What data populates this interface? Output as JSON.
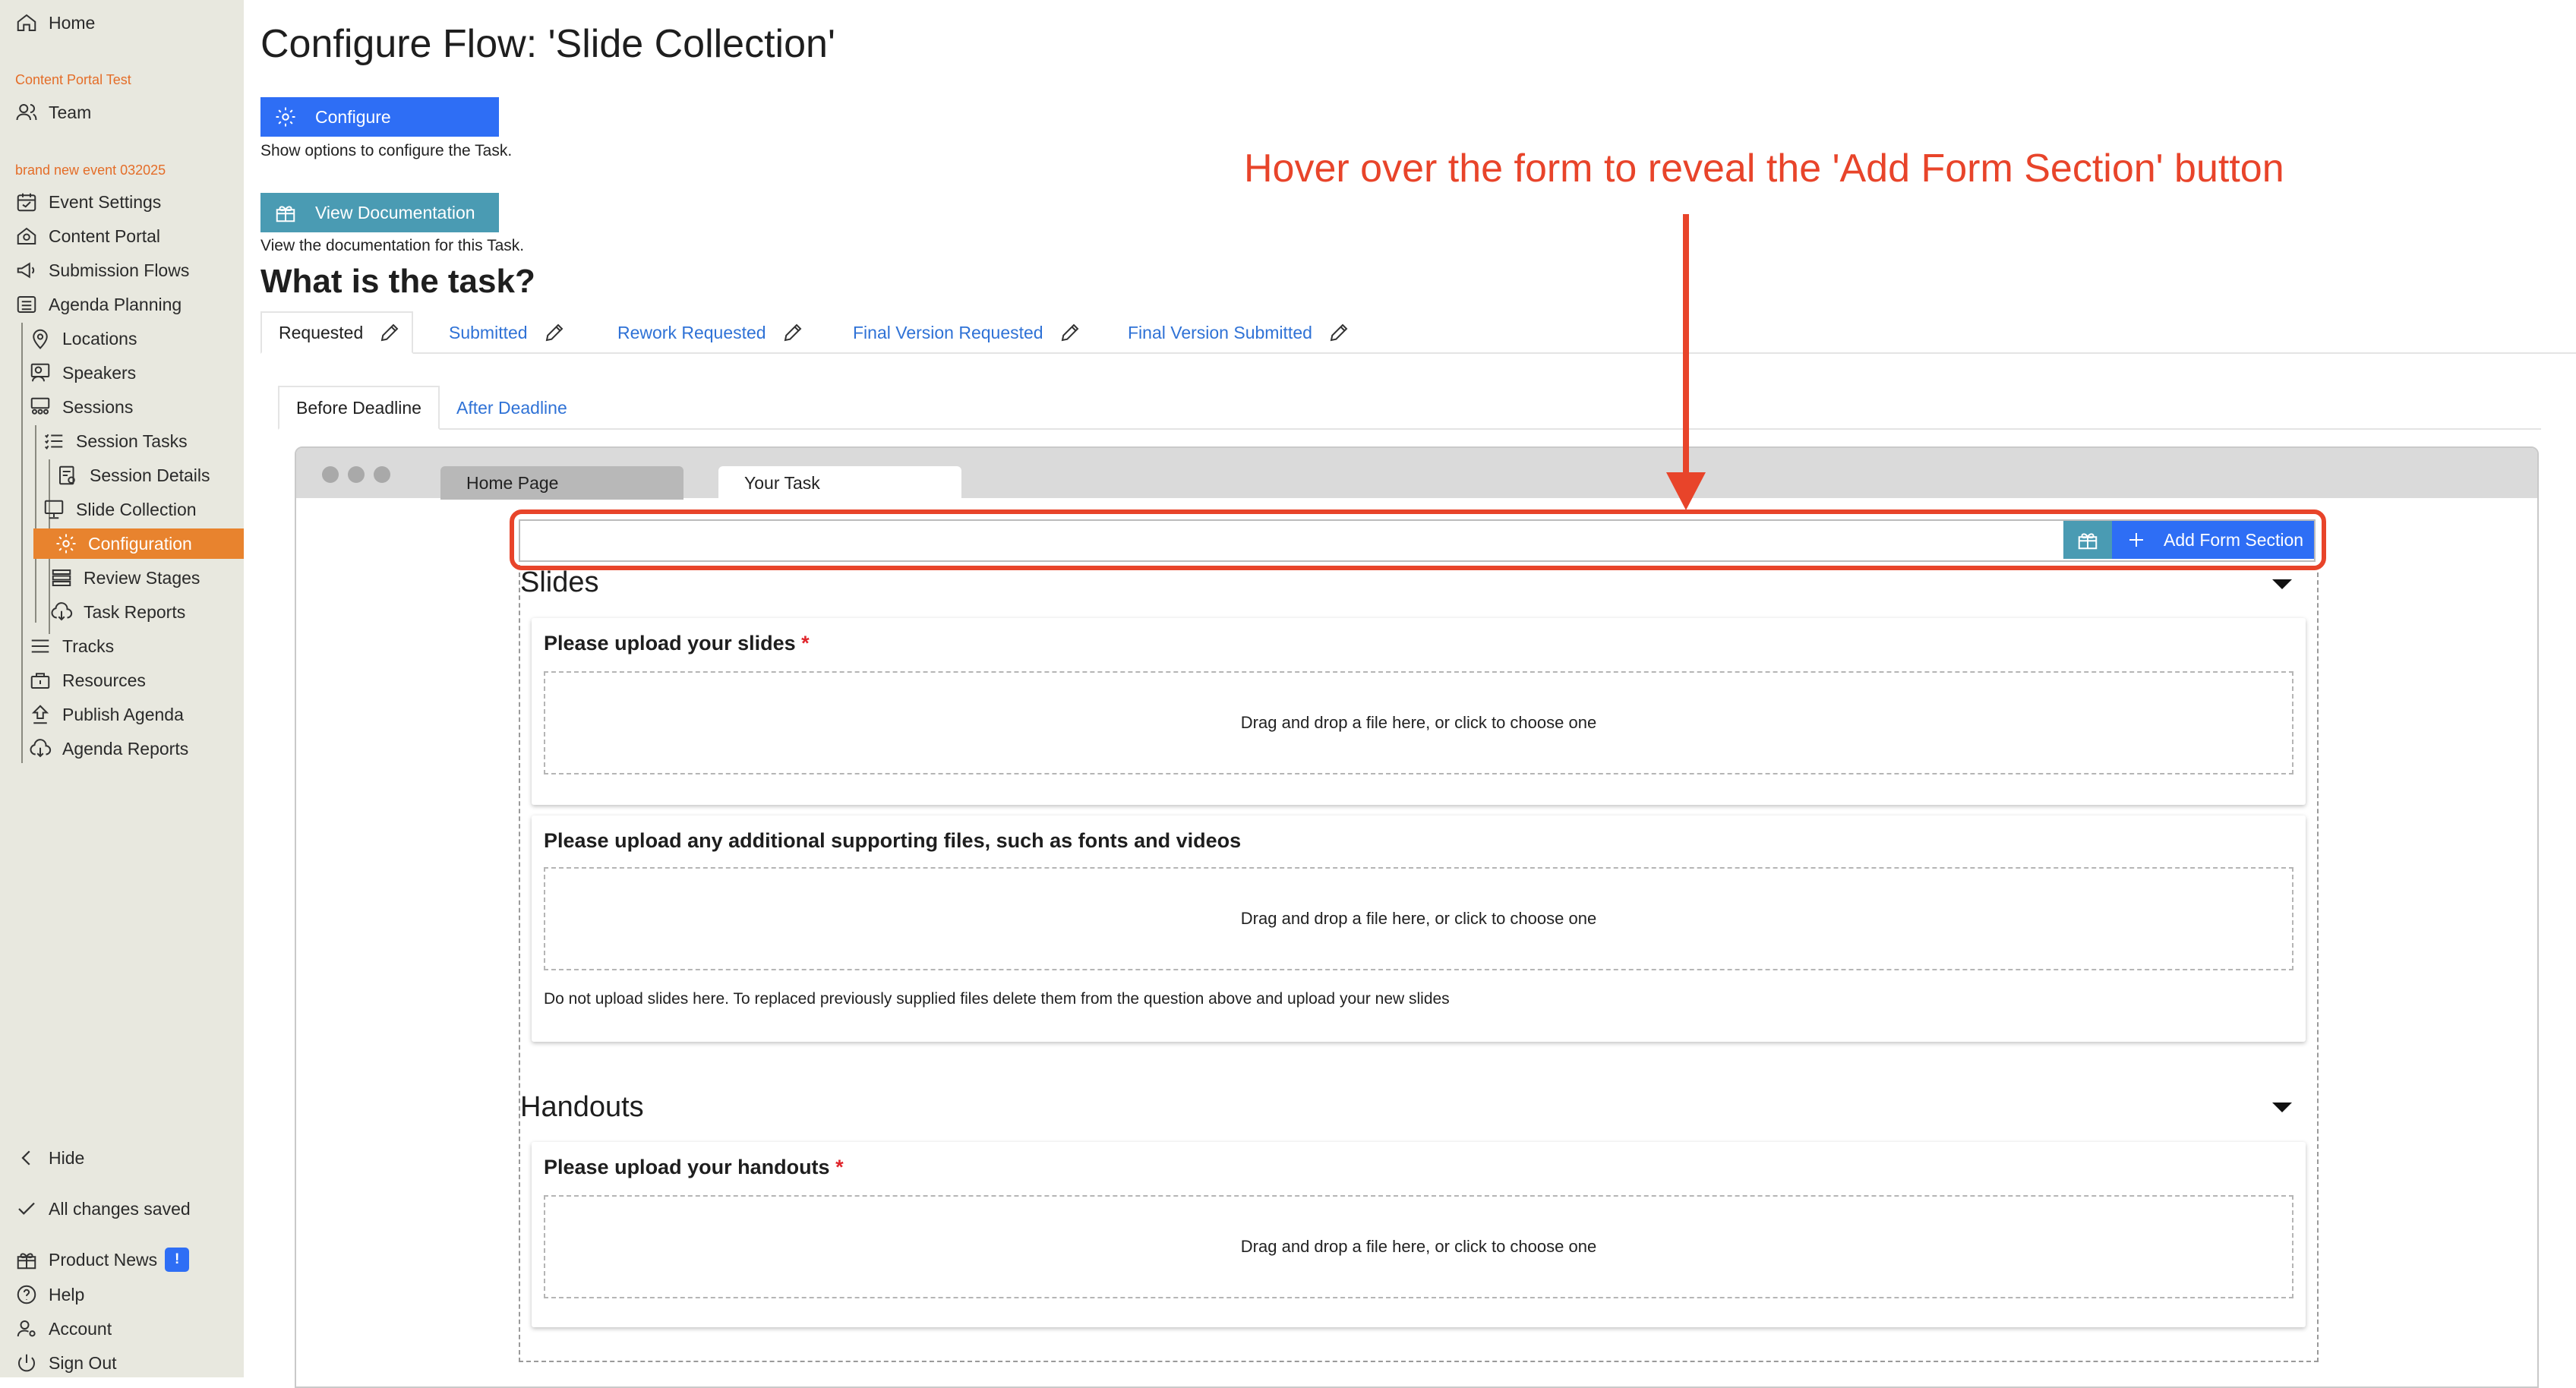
{
  "sidebar": {
    "home": "Home",
    "org_label": "Content Portal Test",
    "team": "Team",
    "event_label": "brand new event 032025",
    "event_settings": "Event Settings",
    "content_portal": "Content Portal",
    "submission_flows": "Submission Flows",
    "agenda_planning": "Agenda Planning",
    "locations": "Locations",
    "speakers": "Speakers",
    "sessions": "Sessions",
    "session_tasks": "Session Tasks",
    "session_details": "Session Details",
    "slide_collection": "Slide Collection",
    "configuration": "Configuration",
    "review_stages": "Review Stages",
    "task_reports": "Task Reports",
    "tracks": "Tracks",
    "resources": "Resources",
    "publish_agenda": "Publish Agenda",
    "agenda_reports": "Agenda Reports",
    "hide": "Hide",
    "saved_status": "All changes saved",
    "product_news": "Product News",
    "product_news_badge": "!",
    "help": "Help",
    "account": "Account",
    "sign_out": "Sign Out"
  },
  "main": {
    "title": "Configure Flow: 'Slide Collection'",
    "configure_button": "Configure",
    "configure_help": "Show options to configure the Task.",
    "docs_button": "View Documentation",
    "docs_help": "View the documentation for this Task.",
    "task_heading": "What is the task?",
    "status_tabs": [
      "Requested",
      "Submitted",
      "Rework Requested",
      "Final Version Requested",
      "Final Version Submitted"
    ],
    "deadline_tabs": [
      "Before Deadline",
      "After Deadline"
    ],
    "annotation": "Hover over the form to reveal the 'Add Form Section' button"
  },
  "browser": {
    "tabs": [
      "Home Page",
      "Your Task"
    ]
  },
  "form": {
    "add_section_button": "Add Form Section",
    "sections": [
      {
        "title": "Slides",
        "questions": [
          {
            "label": "Please upload your slides",
            "required": "*",
            "dropzone": "Drag and drop a file here, or click to choose one"
          },
          {
            "label": "Please upload any additional supporting files, such as fonts and videos",
            "dropzone": "Drag and drop a file here, or click to choose one",
            "help": "Do not upload slides here. To replaced previously supplied files delete them from the question above and upload your new slides"
          }
        ]
      },
      {
        "title": "Handouts",
        "questions": [
          {
            "label": "Please upload your handouts",
            "required": "*",
            "dropzone": "Drag and drop a file here, or click to choose one"
          }
        ]
      }
    ]
  },
  "colors": {
    "accent_orange": "#e8832e",
    "primary_blue": "#2e6ef5",
    "teal": "#4a9bb3",
    "annotation_red": "#e8442a",
    "sidebar_bg": "#e8e8df"
  },
  "icons": [
    "home-icon",
    "team-icon",
    "calendar-icon",
    "portal-icon",
    "megaphone-icon",
    "list-icon",
    "location-pin-icon",
    "speaker-icon",
    "sessions-icon",
    "tasks-icon",
    "details-icon",
    "monitor-icon",
    "gear-icon",
    "stages-icon",
    "cloud-download-icon",
    "lines-icon",
    "resources-icon",
    "publish-icon",
    "chevron-left-icon",
    "check-icon",
    "gift-icon",
    "question-icon",
    "account-icon",
    "power-icon",
    "pencil-icon",
    "plus-icon",
    "caret-down-icon"
  ]
}
